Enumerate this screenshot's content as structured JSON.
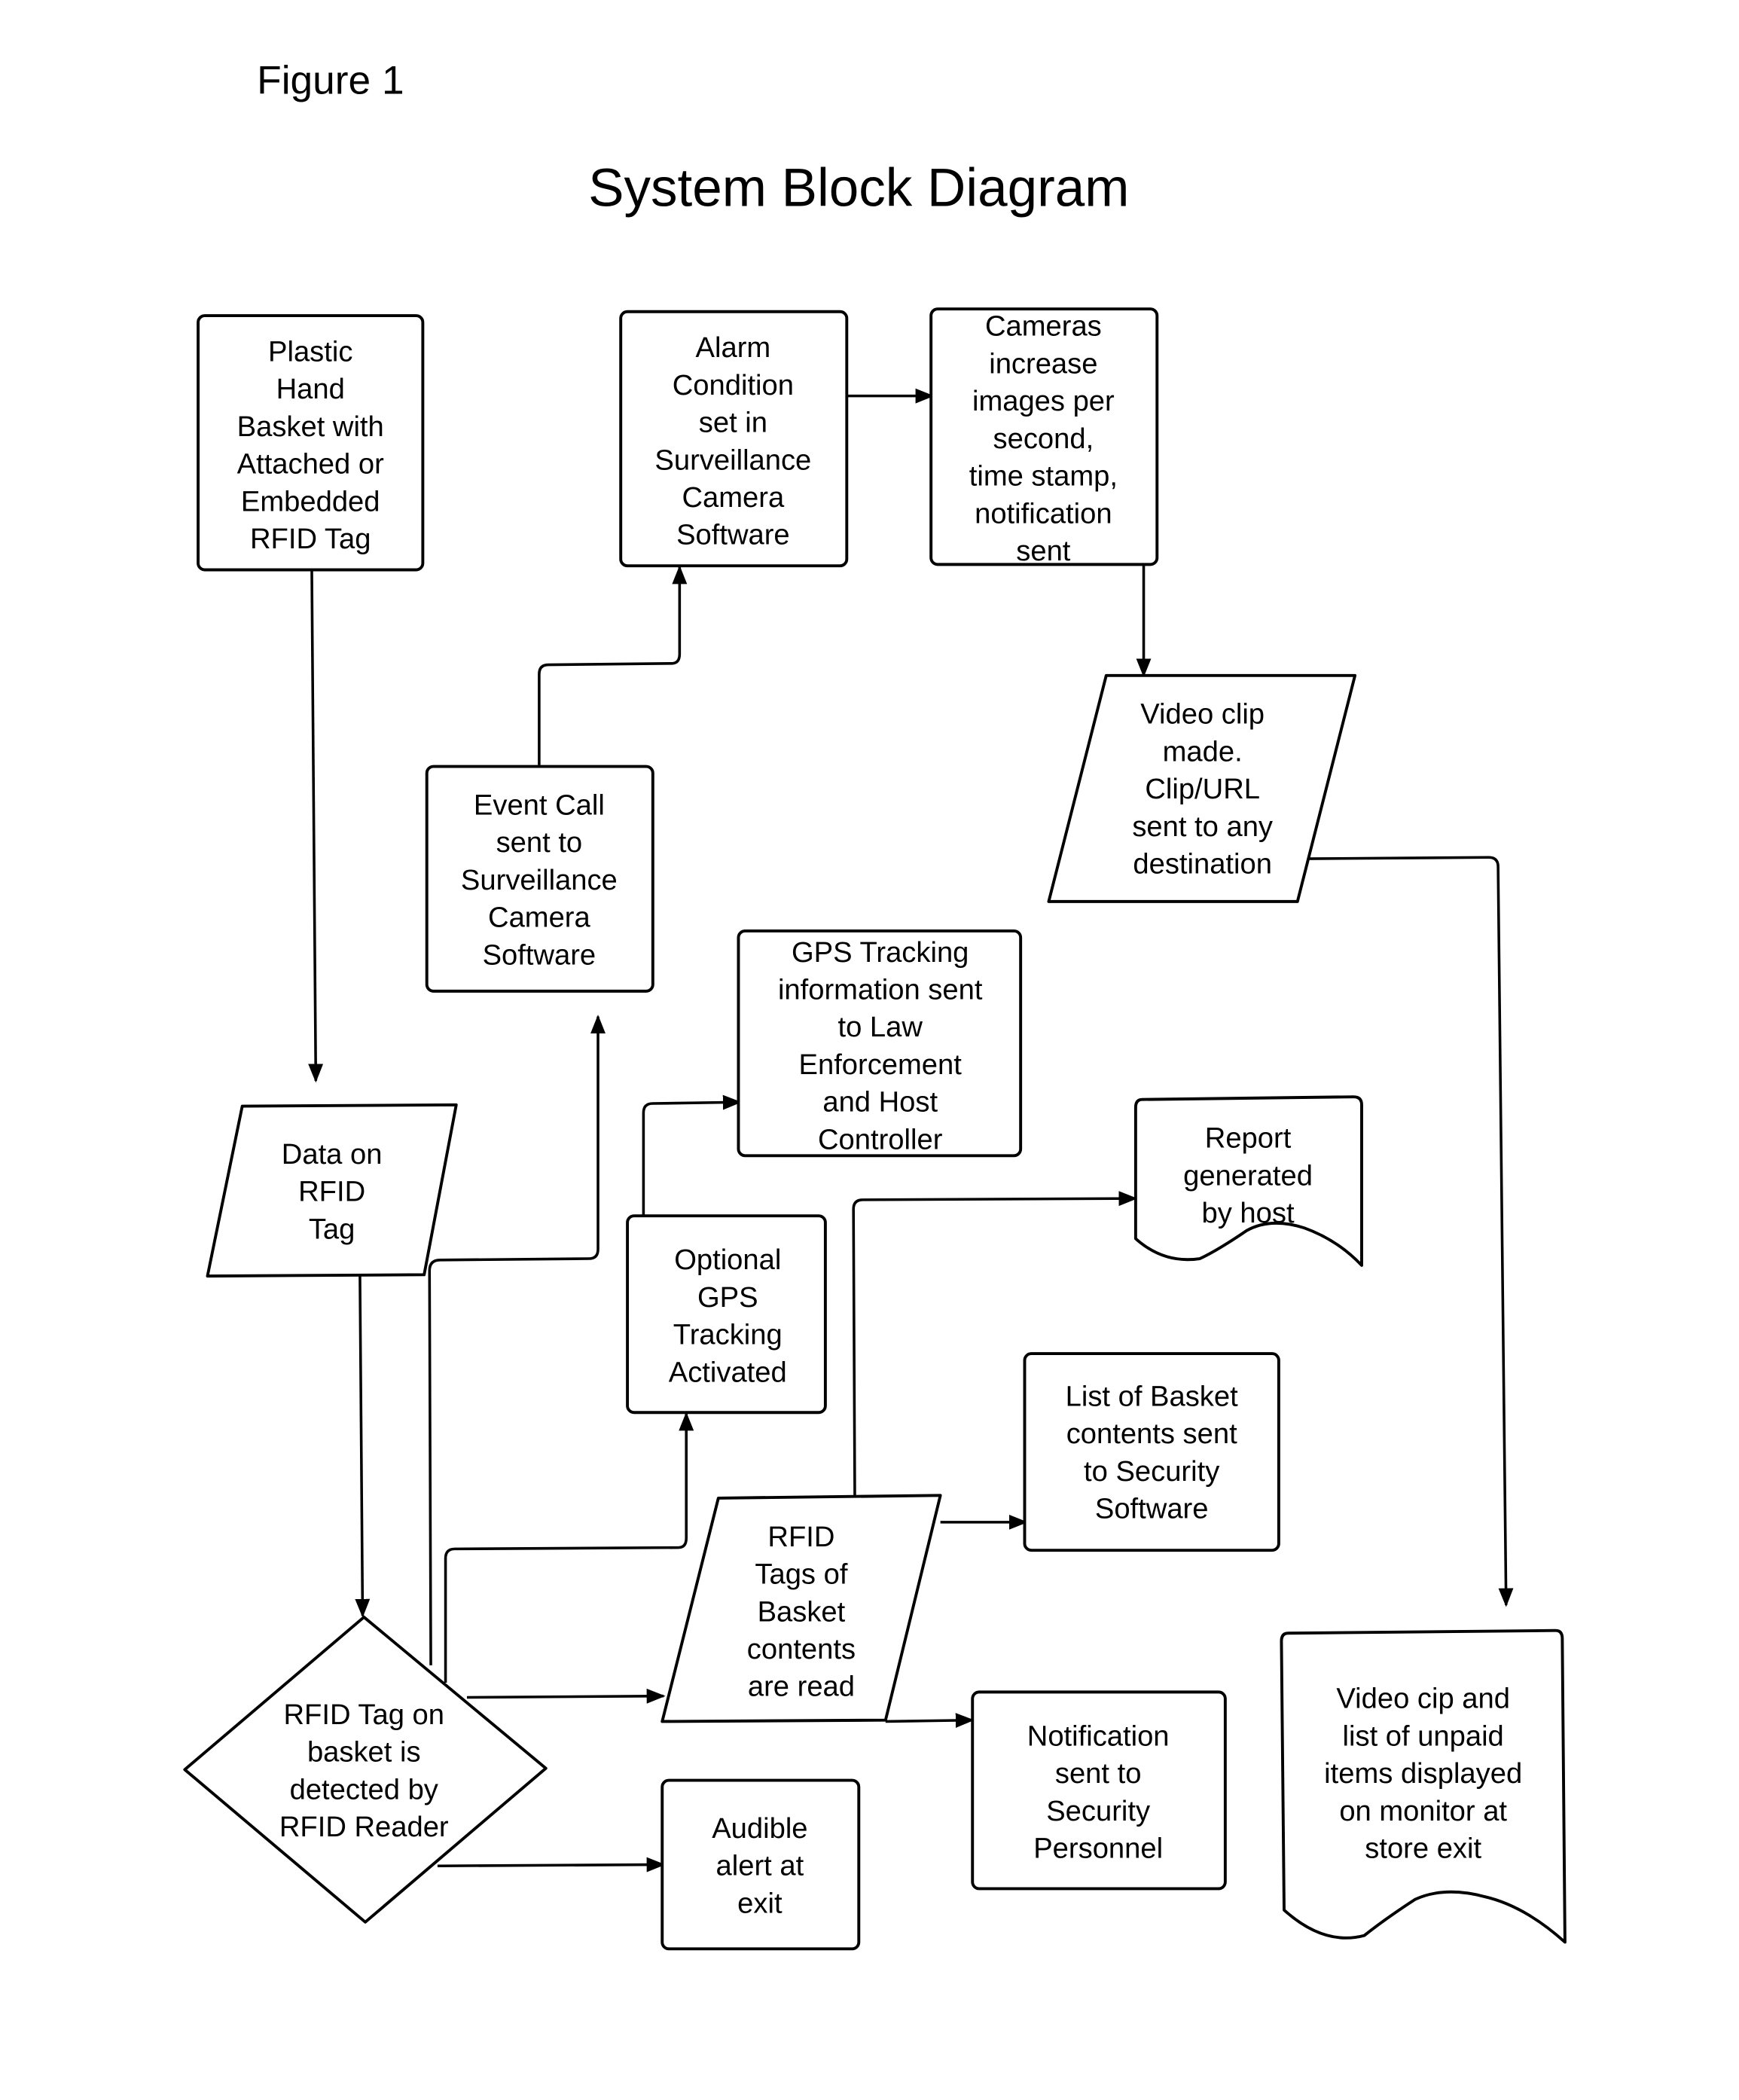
{
  "figure_label": "Figure 1",
  "title": "System Block Diagram",
  "nodes": {
    "basket": {
      "shape": "rounded-rect",
      "lines": [
        "Plastic",
        "Hand",
        "Basket with",
        "Attached or",
        "Embedded",
        "RFID Tag"
      ]
    },
    "alarm": {
      "shape": "rounded-rect",
      "lines": [
        "Alarm",
        "Condition",
        "set in",
        "Surveillance",
        "Camera",
        "Software"
      ]
    },
    "cameras": {
      "shape": "rounded-rect",
      "lines": [
        "Cameras",
        "increase",
        "images per",
        "second,",
        "time stamp,",
        "notification",
        "sent"
      ]
    },
    "video_clip": {
      "shape": "parallelogram",
      "lines": [
        "Video clip",
        "made.",
        "Clip/URL",
        "sent to any",
        "destination"
      ]
    },
    "event_call": {
      "shape": "rounded-rect",
      "lines": [
        "Event Call",
        "sent to",
        "Surveillance",
        "Camera",
        "Software"
      ]
    },
    "gps_info": {
      "shape": "rounded-rect",
      "lines": [
        "GPS Tracking",
        "information sent",
        "to Law",
        "Enforcement",
        "and Host",
        "Controller"
      ]
    },
    "data_on_tag": {
      "shape": "parallelogram",
      "lines": [
        "Data on",
        "RFID",
        "Tag"
      ]
    },
    "report": {
      "shape": "document",
      "lines": [
        "Report",
        "generated",
        "by host"
      ]
    },
    "optional_gps": {
      "shape": "rounded-rect",
      "lines": [
        "Optional",
        "GPS",
        "Tracking",
        "Activated"
      ]
    },
    "list_basket": {
      "shape": "rounded-rect",
      "lines": [
        "List of Basket",
        "contents sent",
        "to Security",
        "Software"
      ]
    },
    "rfid_contents": {
      "shape": "parallelogram",
      "lines": [
        "RFID",
        "Tags of",
        "Basket",
        "contents",
        "are read"
      ]
    },
    "detected": {
      "shape": "diamond",
      "lines": [
        "RFID Tag on",
        "basket is",
        "detected by",
        "RFID Reader"
      ]
    },
    "notification": {
      "shape": "rounded-rect",
      "lines": [
        "Notification",
        "sent to",
        "Security",
        "Personnel"
      ]
    },
    "audible": {
      "shape": "rounded-rect",
      "lines": [
        "Audible",
        "alert at",
        "exit"
      ]
    },
    "monitor": {
      "shape": "document",
      "lines": [
        "Video cip and",
        "list of unpaid",
        "items displayed",
        "on monitor at",
        "store exit"
      ]
    }
  },
  "edges": [
    {
      "from": "basket",
      "to": "data_on_tag"
    },
    {
      "from": "data_on_tag",
      "to": "detected"
    },
    {
      "from": "detected",
      "to": "event_call"
    },
    {
      "from": "event_call",
      "to": "alarm"
    },
    {
      "from": "alarm",
      "to": "cameras"
    },
    {
      "from": "cameras",
      "to": "video_clip"
    },
    {
      "from": "video_clip",
      "to": "monitor"
    },
    {
      "from": "detected",
      "to": "optional_gps"
    },
    {
      "from": "optional_gps",
      "to": "gps_info"
    },
    {
      "from": "detected",
      "to": "rfid_contents"
    },
    {
      "from": "rfid_contents",
      "to": "report"
    },
    {
      "from": "rfid_contents",
      "to": "list_basket"
    },
    {
      "from": "rfid_contents",
      "to": "notification"
    },
    {
      "from": "detected",
      "to": "audible"
    }
  ]
}
